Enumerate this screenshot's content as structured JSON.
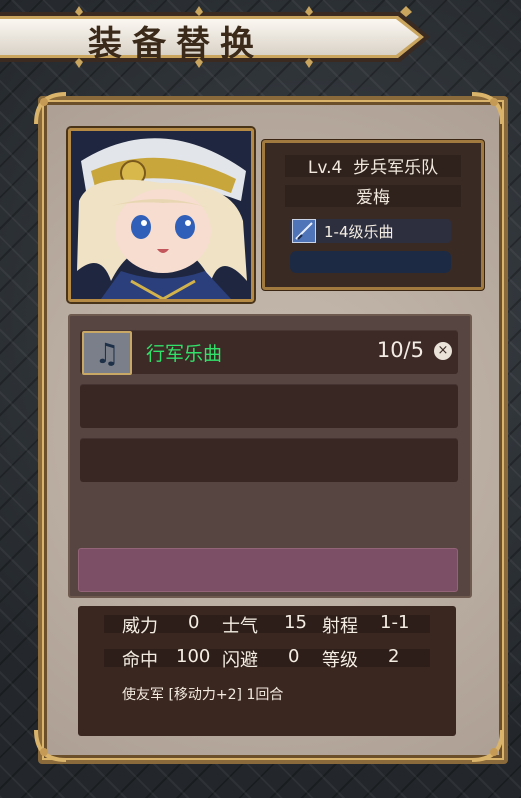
{
  "title": "装备替换",
  "character": {
    "level": "Lv.4",
    "class": "步兵军乐队",
    "name": "爱梅",
    "equip_category": "1-4级乐曲",
    "empty_slot": ""
  },
  "equipment_list": [
    {
      "name": "行军乐曲",
      "count": "10/5",
      "icon": "music-note-icon",
      "close": "×"
    },
    {
      "name": "",
      "count": ""
    },
    {
      "name": "",
      "count": ""
    }
  ],
  "stats": {
    "power_label": "威力",
    "power": "0",
    "morale_label": "士气",
    "morale": "15",
    "range_label": "射程",
    "range": "1-1",
    "hit_label": "命中",
    "hit": "100",
    "evade_label": "闪避",
    "evade": "0",
    "level_label": "等级",
    "level": "2",
    "description": "使友军 [移动力+2] 1回合"
  },
  "colors": {
    "equip_name": "#32e16a",
    "highlight_slot": "#7c4f66",
    "frame_gold": "#b48a45"
  }
}
